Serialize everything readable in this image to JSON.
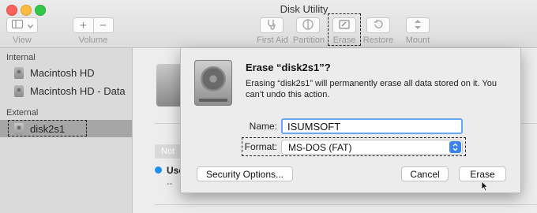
{
  "window": {
    "title": "Disk Utility"
  },
  "toolbar": {
    "view_label": "View",
    "volume_label": "Volume",
    "volume_add": "+",
    "volume_remove": "−",
    "first_aid_label": "First Aid",
    "partition_label": "Partition",
    "erase_label": "Erase",
    "restore_label": "Restore",
    "mount_label": "Mount"
  },
  "sidebar": {
    "internal_header": "Internal",
    "external_header": "External",
    "internal_items": [
      {
        "label": "Macintosh HD"
      },
      {
        "label": "Macintosh HD - Data"
      }
    ],
    "external_items": [
      {
        "label": "disk2s1",
        "selected": true
      }
    ]
  },
  "main": {
    "pill_text": "Not",
    "legend_label": "Use",
    "legend_value": "--"
  },
  "dialog": {
    "title": "Erase “disk2s1”?",
    "message": "Erasing “disk2s1” will permanently erase all data stored on it. You can’t undo this action.",
    "name_label": "Name:",
    "name_value": "ISUMSOFT",
    "format_label": "Format:",
    "format_value": "MS-DOS (FAT)",
    "security_button": "Security Options...",
    "cancel_button": "Cancel",
    "erase_button": "Erase"
  },
  "colors": {
    "accent": "#3b82f0",
    "focus_ring": "#6aa5f0",
    "selection": "#a6a6a6"
  },
  "icons": [
    "sidebar-view-icon",
    "chevron-down-icon",
    "plus-icon",
    "minus-icon",
    "stethoscope-icon",
    "partition-icon",
    "erase-icon",
    "restore-icon",
    "mount-icon",
    "hard-drive-icon",
    "external-drive-icon",
    "select-arrows-icon",
    "mouse-cursor-icon"
  ]
}
